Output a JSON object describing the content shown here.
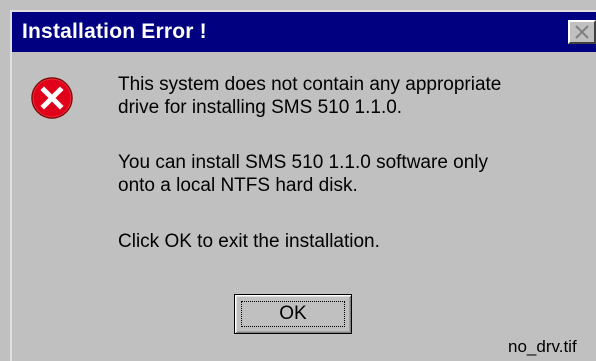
{
  "window": {
    "title": "Installation Error !",
    "close_icon": "close-icon"
  },
  "message": {
    "icon": "error-icon",
    "line1": "This system does not contain any appropriate",
    "line2": "drive for installing SMS 510 1.1.0.",
    "line3": "You can install SMS 510 1.1.0 software only",
    "line4": "onto a local NTFS hard disk.",
    "line5": "Click OK to exit the installation."
  },
  "buttons": {
    "ok_label": "OK"
  },
  "caption": "no_drv.tif",
  "colors": {
    "titlebar": "#000080",
    "dialog_bg": "#c0c0c0",
    "error_red": "#e0001a"
  }
}
